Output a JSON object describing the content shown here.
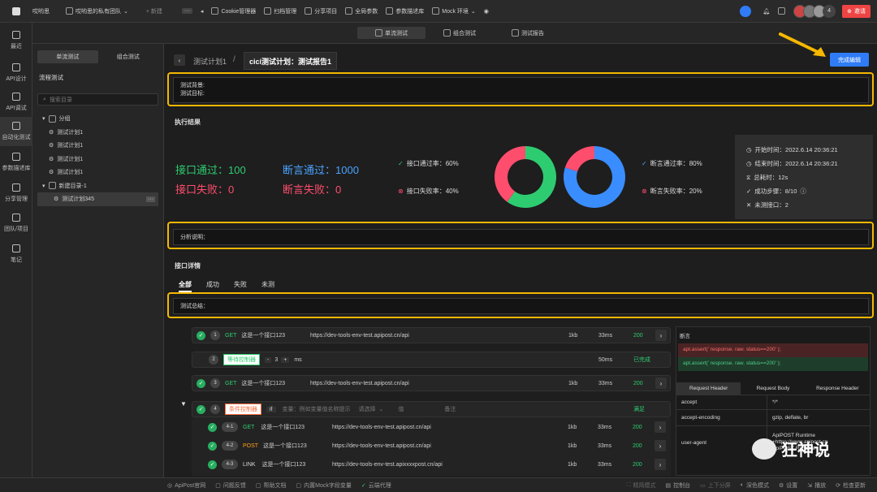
{
  "topbar": {
    "app": "哎哟思",
    "team": "哎哟思的私有团队",
    "new": "+ 新建",
    "items": [
      "Cookie管理器",
      "扫档管理",
      "分享项目",
      "全局参数",
      "参数描述库",
      "Mock 环境"
    ],
    "avatar_count": "4",
    "invite": "邀请"
  },
  "rail": [
    "最近",
    "API设计",
    "API调试",
    "自动化测试",
    "参数描述库",
    "分享管理",
    "团队/项目",
    "笔记"
  ],
  "sidebar": {
    "tabs": [
      "单流测试",
      "组合测试"
    ],
    "section": "流程测试",
    "search_placeholder": "搜索目录",
    "tree": [
      "分组",
      "测试计划1",
      "测试计划1",
      "测试计划1",
      "测试计划1",
      "新建目录-1",
      "测试计划345"
    ]
  },
  "main_tabs": [
    "单流测试",
    "组合测试",
    "测试报告"
  ],
  "breadcrumb": {
    "parent": "测试计划1",
    "sep": "/",
    "current": "cici测试计划：测试报告1"
  },
  "complete_button": "完成编辑",
  "bg_box": {
    "line1": "测试背景:",
    "line2": "测试目标:"
  },
  "exec_title": "执行结果",
  "stats": {
    "api_pass": "接口通过：100",
    "api_fail": "接口失败：0",
    "assert_pass": "断言通过：1000",
    "assert_fail": "断言失败：0",
    "api_pass_rate": "接口通过率：60%",
    "api_fail_rate": "接口失败率：40%",
    "assert_pass_rate": "断言通过率：80%",
    "assert_fail_rate": "断言失败率：20%"
  },
  "chart_data": [
    {
      "type": "pie",
      "name": "接口通过率",
      "categories": [
        "通过",
        "失败"
      ],
      "values": [
        60,
        40
      ],
      "colors": [
        "#2ecc71",
        "#ff4d6d"
      ]
    },
    {
      "type": "pie",
      "name": "断言通过率",
      "categories": [
        "通过",
        "失败"
      ],
      "values": [
        80,
        20
      ],
      "colors": [
        "#3a8dff",
        "#ff4d6d"
      ]
    }
  ],
  "timeinfo": {
    "start": "开始时间：2022.6.14 20:36:21",
    "end": "结束时间：2022.6.14 20:36:21",
    "total": "总耗时：12s",
    "steps": "成功步骤：8/10",
    "untested": "未测接口：2"
  },
  "analysis": "分析说明：",
  "detail_title": "接口详情",
  "filter_tabs": [
    "全部",
    "成功",
    "失败",
    "未测"
  ],
  "summary": "测试总结：",
  "rows": [
    {
      "n": "1",
      "method": "GET",
      "name": "这是一个接口123",
      "url": "https://dev-tools-env-test.apipost.cn/api",
      "size": "1kb",
      "time": "33ms",
      "status": "200"
    },
    {
      "n": "2",
      "ctrl": "等待控制器",
      "minus": "-",
      "val": "3",
      "plus": "+",
      "unit": "ms",
      "time": "50ms",
      "status": "已完成"
    },
    {
      "n": "3",
      "method": "GET",
      "name": "这是一个接口123",
      "url": "https://dev-tools-env-test.apipost.cn/api",
      "size": "1kb",
      "time": "33ms",
      "status": "200"
    },
    {
      "n": "4",
      "ctrl": "条件控制器",
      "if": "if",
      "var": "变量：例如变量值名称提示",
      "select": "请选择",
      "value": "值",
      "note": "备注",
      "status": "满足"
    }
  ],
  "subrows": [
    {
      "n": "4-1",
      "method": "GET",
      "name": "这是一个接口123",
      "url": "https://dev-tools-env-test.apipost.cn/api",
      "size": "1kb",
      "time": "33ms",
      "status": "200"
    },
    {
      "n": "4-2",
      "method": "POST",
      "name": "这是一个接口123",
      "url": "https://dev-tools-env-test.apipost.cn/api",
      "size": "1kb",
      "time": "33ms",
      "status": "200"
    },
    {
      "n": "4-3",
      "method": "LINK",
      "name": "这是一个接口123",
      "url": "https://dev-tools-env-test.apixxxxpost.cn/api",
      "size": "1kb",
      "time": "33ms",
      "status": "200"
    }
  ],
  "assert_panel": {
    "title": "断言",
    "fail": "apt.assert(' response. raw. status==200' );",
    "pass": "apt.assert(' response. raw. status==200' );",
    "tabs": [
      "Request Header",
      "Request Body",
      "Response Header"
    ],
    "headers": [
      {
        "k": "accept",
        "v": "*/*"
      },
      {
        "k": "accept-encoding",
        "v": "gzip, deflate, br"
      },
      {
        "k": "user-agent",
        "v": "ApiPOST Runtime +https://www.apipost.cn ApiPOST Runtime"
      }
    ]
  },
  "watermark": "狂神说",
  "bottom_left": [
    "ApiPost官网",
    "问题反馈",
    "帮助文档",
    "内置Mock字段变量",
    "云端代理"
  ],
  "bottom_right": [
    "精简模式",
    "控制台",
    "上下分屏",
    "深色模式",
    "设置",
    "播放",
    "检查更新"
  ]
}
